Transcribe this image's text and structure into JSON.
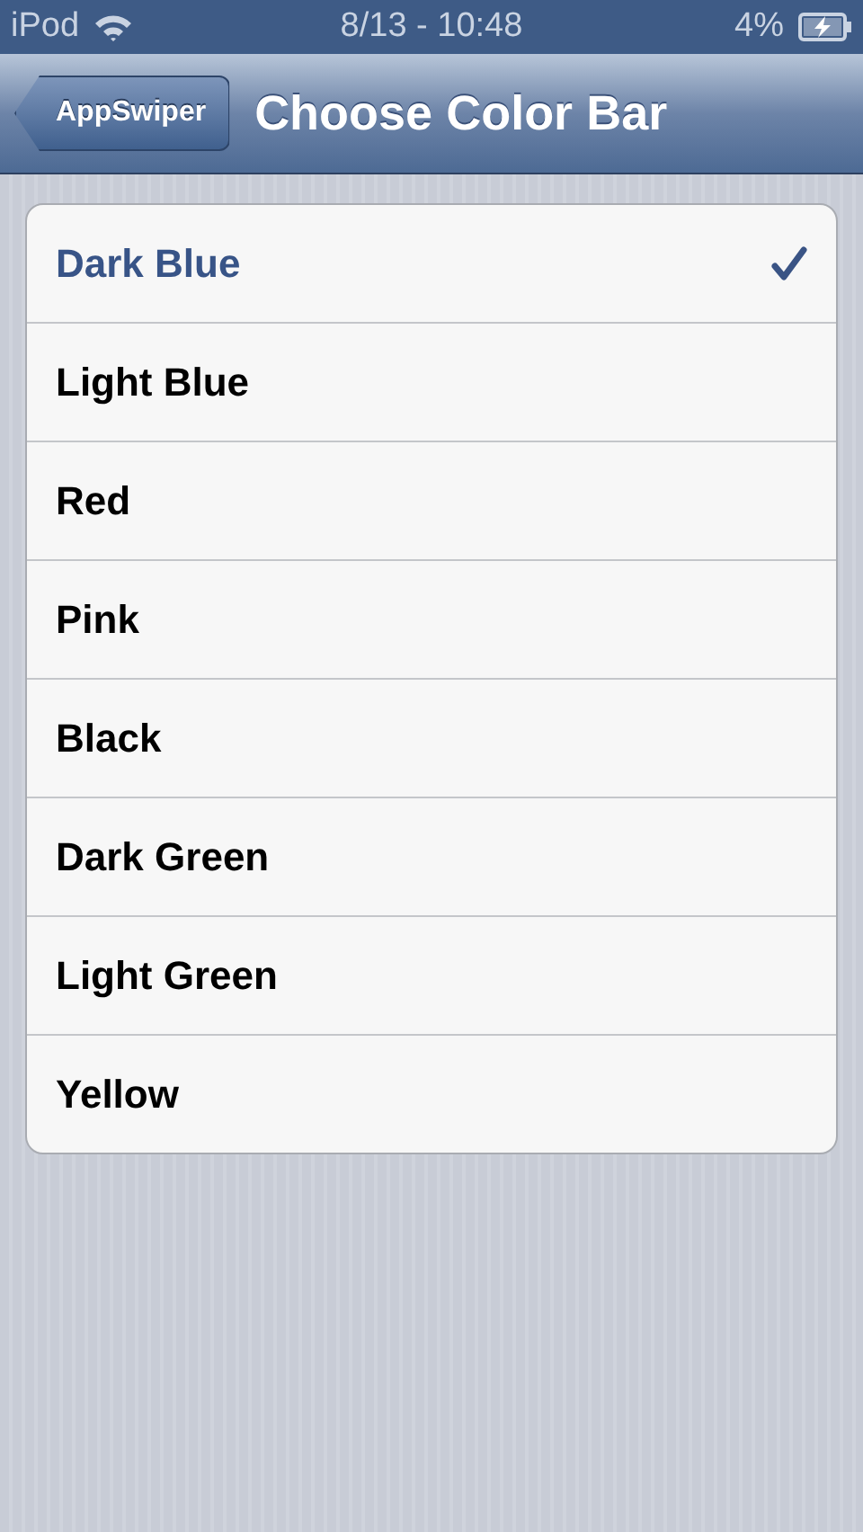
{
  "status_bar": {
    "carrier": "iPod",
    "time": "8/13 - 10:48",
    "battery": "4%",
    "charging": true
  },
  "nav_bar": {
    "back": "AppSwiper",
    "title": "Choose Color Bar"
  },
  "options": [
    {
      "label": "Dark Blue",
      "selected": true
    },
    {
      "label": "Light Blue",
      "selected": false
    },
    {
      "label": "Red",
      "selected": false
    },
    {
      "label": "Pink",
      "selected": false
    },
    {
      "label": "Black",
      "selected": false
    },
    {
      "label": "Dark Green",
      "selected": false
    },
    {
      "label": "Light Green",
      "selected": false
    },
    {
      "label": "Yellow",
      "selected": false
    }
  ]
}
